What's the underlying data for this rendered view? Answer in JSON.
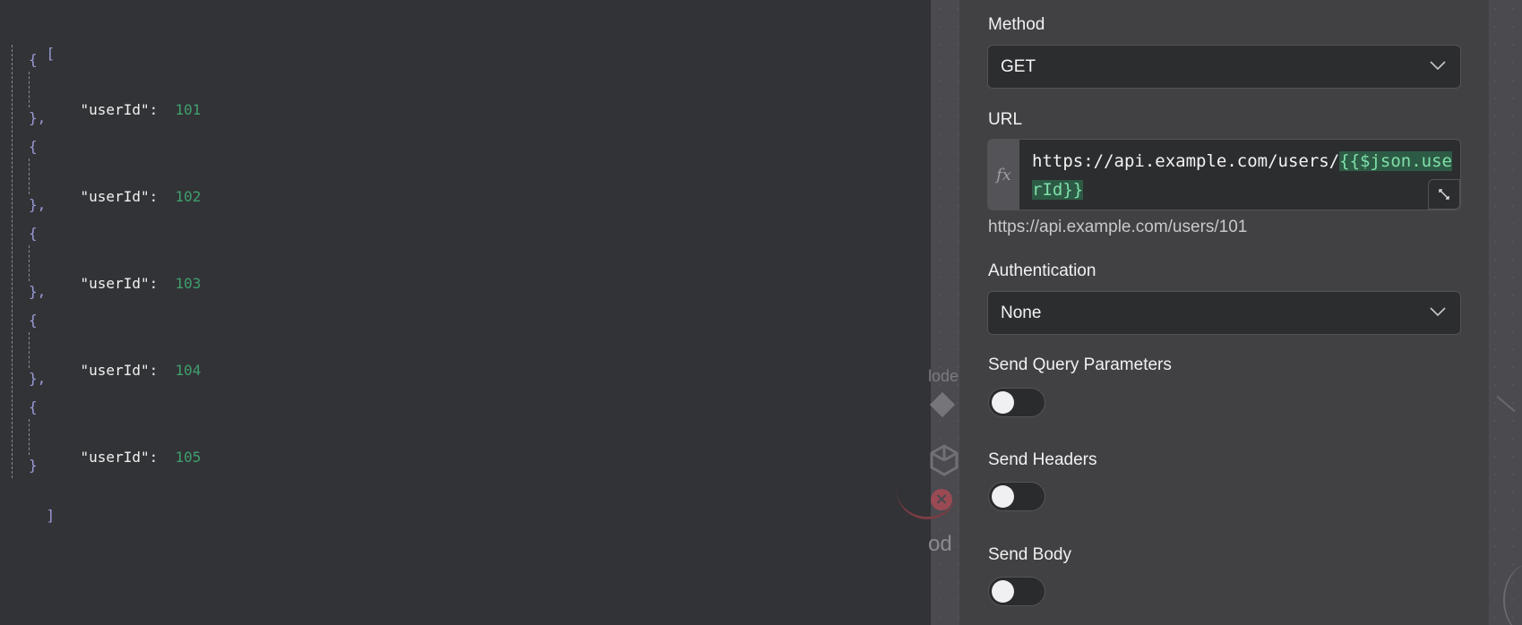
{
  "json_view": {
    "open_bracket": "[",
    "close_bracket": "]",
    "items": [
      {
        "key": "\"userId\"",
        "value": "101"
      },
      {
        "key": "\"userId\"",
        "value": "102"
      },
      {
        "key": "\"userId\"",
        "value": "103"
      },
      {
        "key": "\"userId\"",
        "value": "104"
      },
      {
        "key": "\"userId\"",
        "value": "105"
      }
    ],
    "colors": {
      "punct": "#9a9ad6",
      "number": "#3fa06e"
    }
  },
  "canvas": {
    "ghost_label_top": "lode",
    "ghost_label_bottom": "od"
  },
  "panel": {
    "method": {
      "label": "Method",
      "value": "GET"
    },
    "url": {
      "label": "URL",
      "fx": "fx",
      "prefix": "https://api.example.com/users/",
      "expression": "{{$json.userId}}",
      "preview": "https://api.example.com/users/101"
    },
    "authentication": {
      "label": "Authentication",
      "value": "None"
    },
    "send_query": {
      "label": "Send Query Parameters",
      "enabled": false
    },
    "send_headers": {
      "label": "Send Headers",
      "enabled": false
    },
    "send_body": {
      "label": "Send Body",
      "enabled": false
    },
    "accent": {
      "expression_bg": "#2d5a45",
      "expression_fg": "#7fe0a8"
    }
  }
}
